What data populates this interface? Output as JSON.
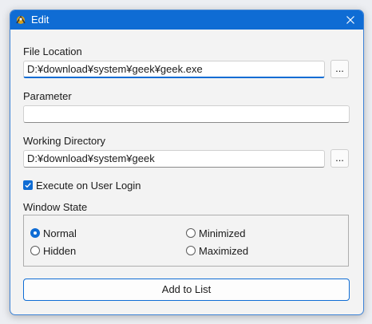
{
  "window": {
    "title": "Edit",
    "icon": "app-icon",
    "close_icon": "close-icon",
    "accent": "#0f6cd4"
  },
  "file_location": {
    "label": "File Location",
    "value": "D:¥download¥system¥geek¥geek.exe",
    "browse_label": "..."
  },
  "parameter": {
    "label": "Parameter",
    "value": ""
  },
  "working_directory": {
    "label": "Working Directory",
    "value": "D:¥download¥system¥geek",
    "browse_label": "..."
  },
  "execute_on_login": {
    "label": "Execute on User Login",
    "checked": true
  },
  "window_state": {
    "label": "Window State",
    "selected": "Normal",
    "options": [
      {
        "label": "Normal",
        "checked": true
      },
      {
        "label": "Minimized",
        "checked": false
      },
      {
        "label": "Hidden",
        "checked": false
      },
      {
        "label": "Maximized",
        "checked": false
      }
    ]
  },
  "add_button": {
    "label": "Add to List"
  }
}
